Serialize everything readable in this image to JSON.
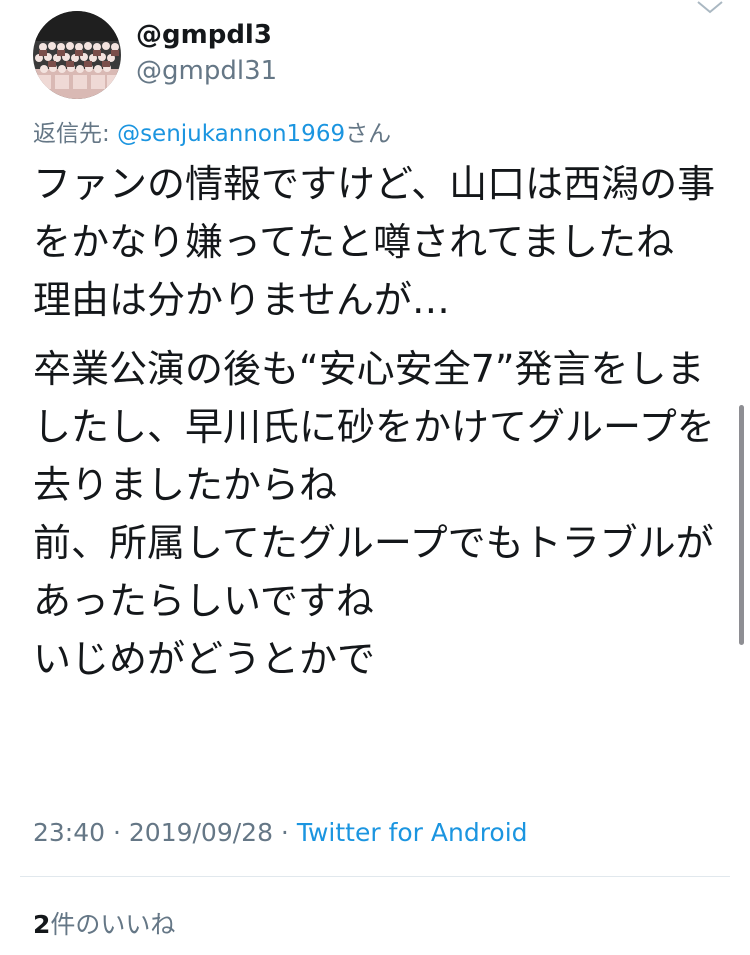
{
  "user": {
    "display_name": "@gmpdl3",
    "handle": "@gmpdl31",
    "avatar": "group-photo-avatar"
  },
  "reply": {
    "prefix": "返信先: ",
    "mention": "@senjukannon1969",
    "suffix": "さん"
  },
  "tweet": {
    "paragraphs": [
      "ファンの情報ですけど、山口は西潟の事をかなり嫌ってたと噂されてましたね\n理由は分かりませんが…",
      "卒業公演の後も“安心安全7”発言をしましたし、早川氏に砂をかけてグループを去りましたからね\n前、所属してたグループでもトラブルがあったらしいですね\nいじめがどうとかで"
    ]
  },
  "meta": {
    "time": "23:40",
    "separator1": " · ",
    "date": "2019/09/28",
    "separator2": " · ",
    "source": "Twitter for Android"
  },
  "likes": {
    "count": "2",
    "label": "件のいいね"
  },
  "icons": {
    "menu": "chevron-down-icon"
  },
  "colors": {
    "text": "#14171a",
    "secondary": "#657786",
    "link": "#1b95e0",
    "divider": "#e1e8ed"
  }
}
